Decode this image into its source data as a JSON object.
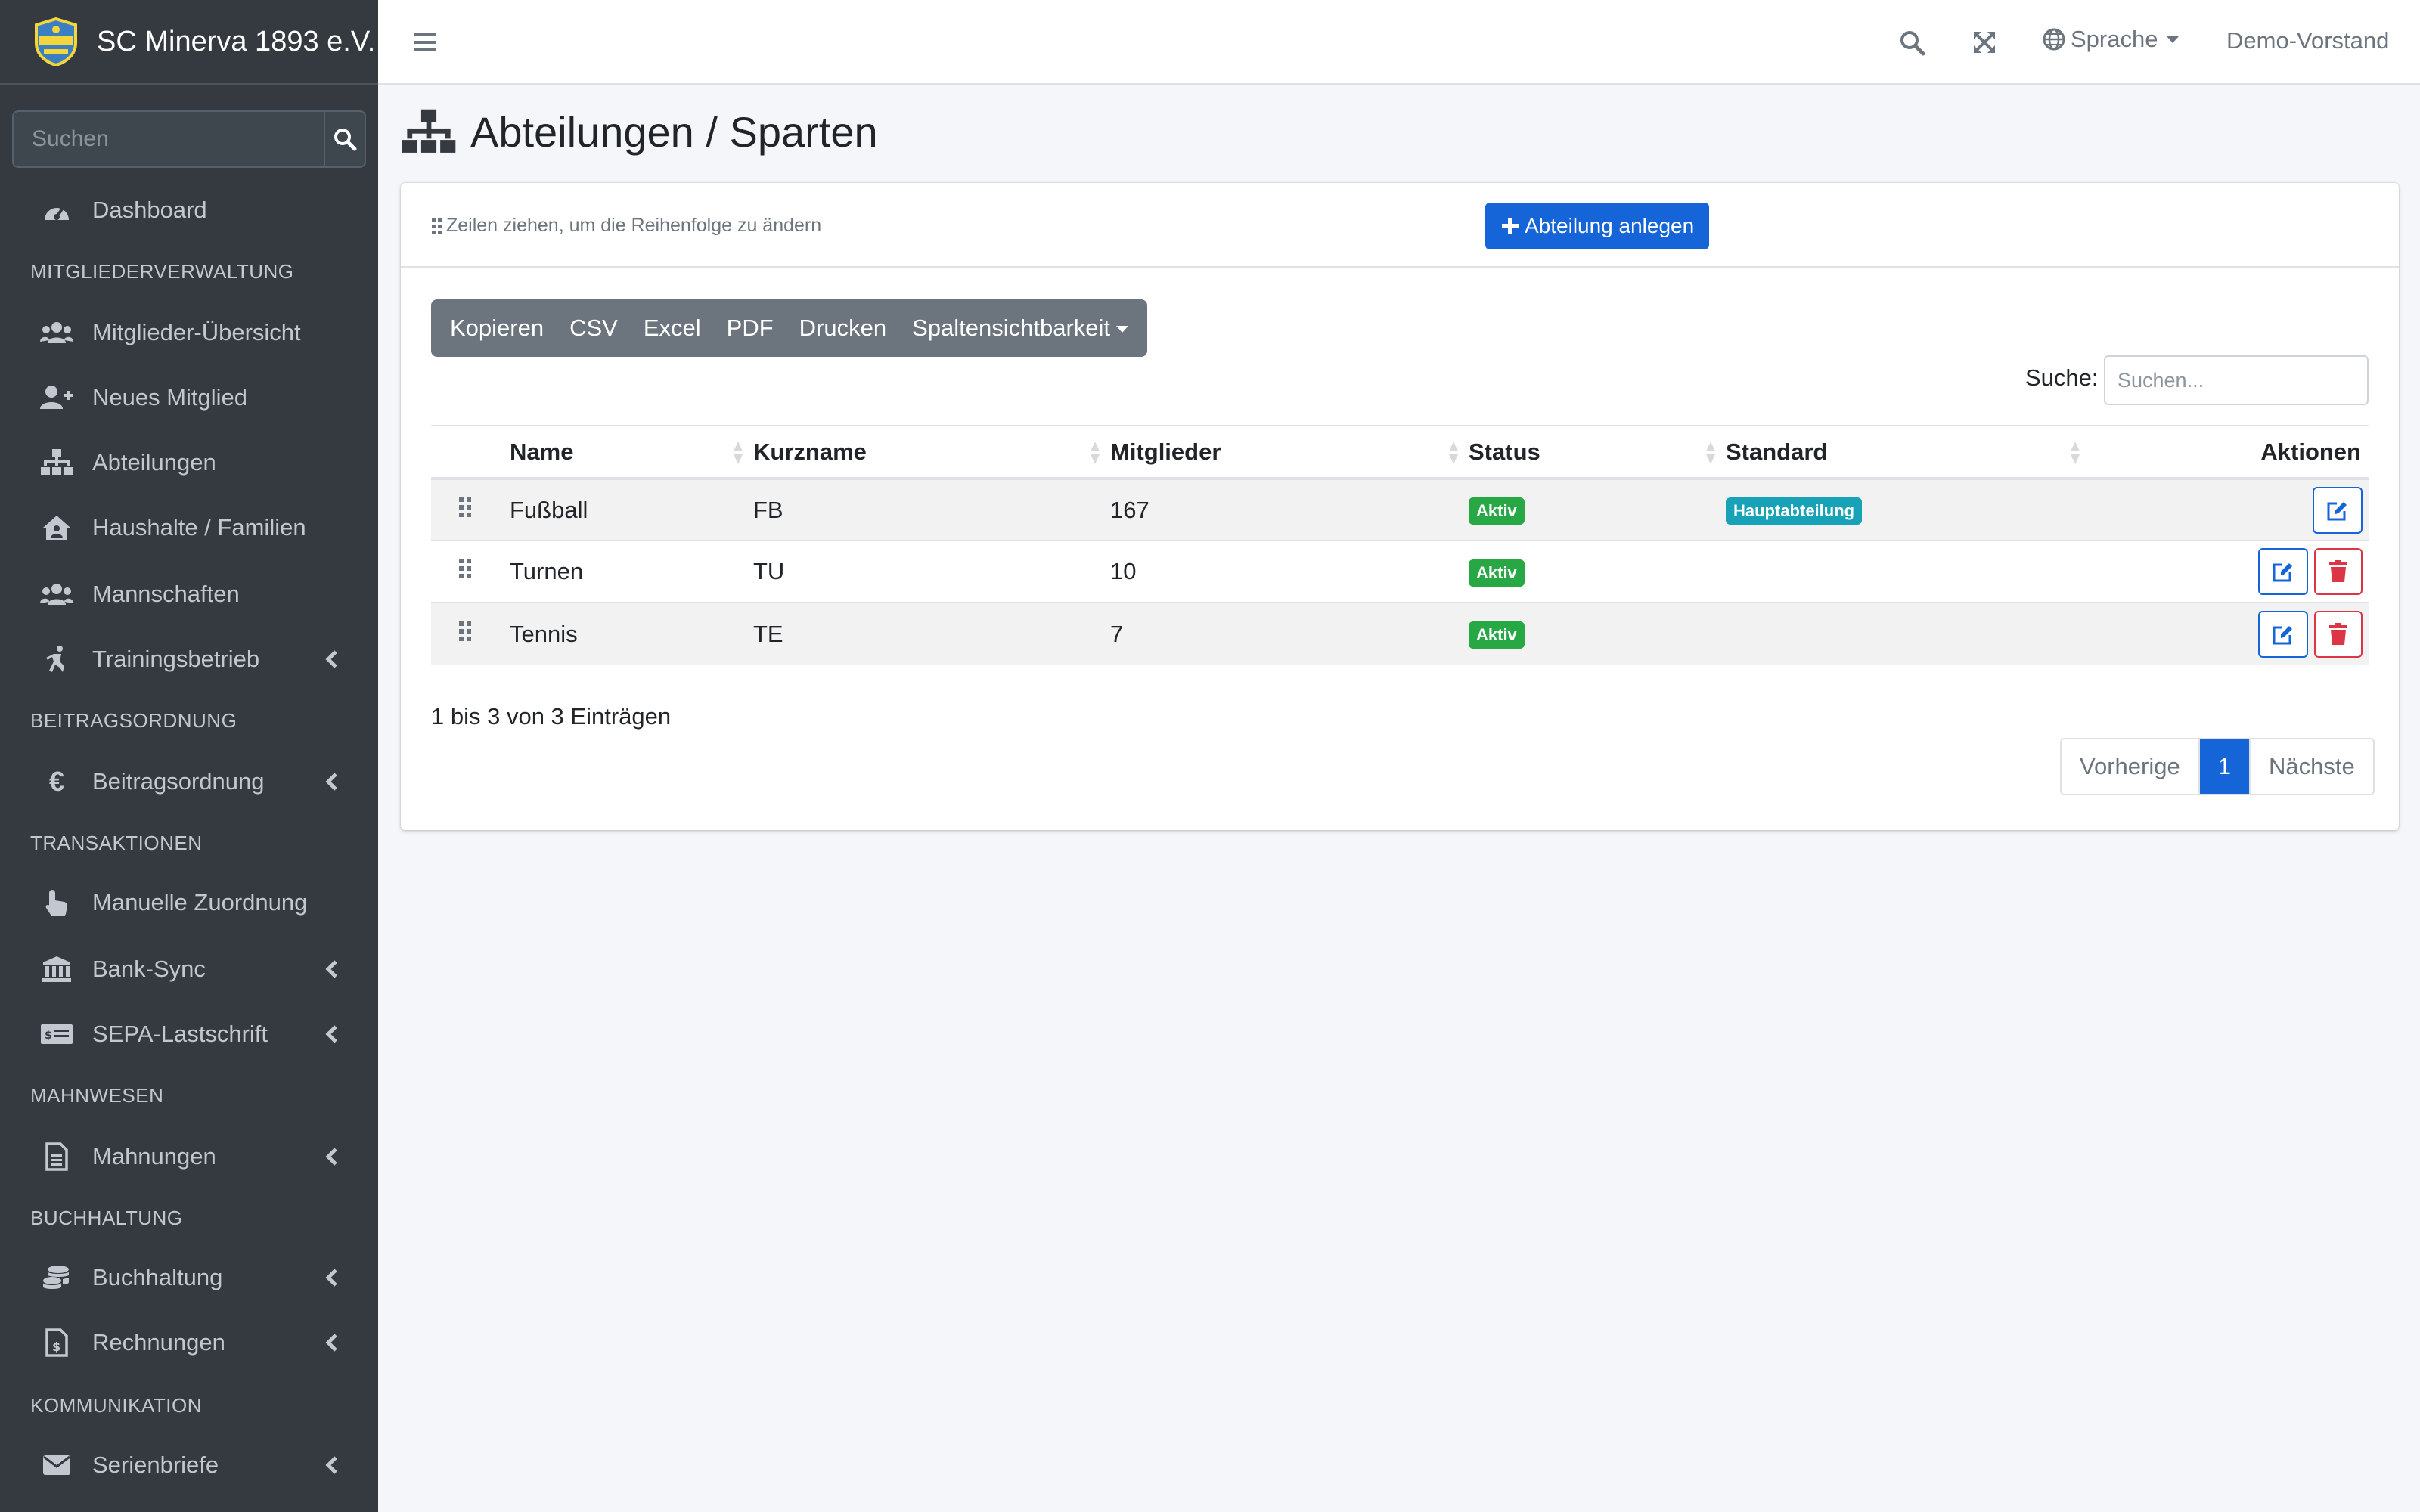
{
  "brand": {
    "name": "SC Minerva 1893 e.V."
  },
  "sidebar": {
    "search_placeholder": "Suchen",
    "items": [
      {
        "label": "Dashboard",
        "icon": "tachometer-icon"
      },
      {
        "label": "Mitglieder-Übersicht",
        "icon": "users-icon"
      },
      {
        "label": "Neues Mitglied",
        "icon": "user-plus-icon"
      },
      {
        "label": "Abteilungen",
        "icon": "sitemap-icon"
      },
      {
        "label": "Haushalte / Familien",
        "icon": "house-user-icon"
      },
      {
        "label": "Mannschaften",
        "icon": "users-icon"
      },
      {
        "label": "Trainingsbetrieb",
        "icon": "running-icon"
      },
      {
        "label": "Beitragsordnung",
        "icon": "euro-icon"
      },
      {
        "label": "Manuelle Zuordnung",
        "icon": "hand-pointer-icon"
      },
      {
        "label": "Bank-Sync",
        "icon": "bank-icon"
      },
      {
        "label": "SEPA-Lastschrift",
        "icon": "money-check-icon"
      },
      {
        "label": "Mahnungen",
        "icon": "file-alt-icon"
      },
      {
        "label": "Buchhaltung",
        "icon": "coins-icon"
      },
      {
        "label": "Rechnungen",
        "icon": "file-invoice-dollar-icon"
      },
      {
        "label": "Serienbriefe",
        "icon": "envelope-icon"
      }
    ],
    "headers": [
      "MITGLIEDERVERWALTUNG",
      "BEITRAGSORDNUNG",
      "TRANSAKTIONEN",
      "MAHNWESEN",
      "BUCHHALTUNG",
      "KOMMUNIKATION"
    ]
  },
  "topbar": {
    "language": "Sprache",
    "user": "Demo-Vorstand"
  },
  "page": {
    "title": "Abteilungen / Sparten",
    "drag_hint": "Zeilen ziehen, um die Reihenfolge zu ändern",
    "add_button": "Abteilung anlegen",
    "export_buttons": [
      "Kopieren",
      "CSV",
      "Excel",
      "PDF",
      "Drucken",
      "Spaltensichtbarkeit"
    ],
    "search_label": "Suche:",
    "search_placeholder": "Suchen...",
    "columns": [
      "Name",
      "Kurzname",
      "Mitglieder",
      "Status",
      "Standard",
      "Aktionen"
    ],
    "rows": [
      {
        "name": "Fußball",
        "short": "FB",
        "members": "167",
        "status": "Aktiv",
        "standard": "Hauptabteilung",
        "deletable": false
      },
      {
        "name": "Turnen",
        "short": "TU",
        "members": "10",
        "status": "Aktiv",
        "standard": "",
        "deletable": true
      },
      {
        "name": "Tennis",
        "short": "TE",
        "members": "7",
        "status": "Aktiv",
        "standard": "",
        "deletable": true
      }
    ],
    "info": "1 bis 3 von 3 Einträgen",
    "pagination": {
      "prev": "Vorherige",
      "current": "1",
      "next": "Nächste"
    }
  },
  "colors": {
    "sidebar_bg": "#343a40",
    "primary": "#1565d8",
    "success": "#28a745",
    "info": "#17a2b8",
    "danger": "#dc3545"
  }
}
